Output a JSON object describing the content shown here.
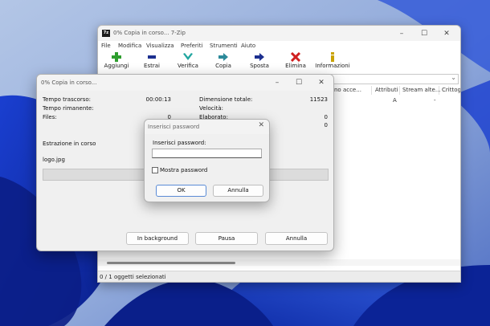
{
  "main_window": {
    "app_icon_text": "7z",
    "title": "0% Copia in corso... 7-Zip",
    "menu": [
      "File",
      "Modifica",
      "Visualizza",
      "Preferiti",
      "Strumenti",
      "Aiuto"
    ],
    "toolbar": [
      {
        "label": "Aggiungi",
        "icon": "plus-icon",
        "color": "#2e9e2e"
      },
      {
        "label": "Estrai",
        "icon": "minus-icon",
        "color": "#1c2f8f"
      },
      {
        "label": "Verifica",
        "icon": "check-icon",
        "color": "#22a6a0"
      },
      {
        "label": "Copia",
        "icon": "arrow-right-icon",
        "color": "#2c8a9a"
      },
      {
        "label": "Sposta",
        "icon": "arrow-right-icon",
        "color": "#1c2f8f"
      },
      {
        "label": "Elimina",
        "icon": "x-icon",
        "color": "#d02020"
      },
      {
        "label": "Informazioni",
        "icon": "info-icon",
        "color": "#c9a200"
      }
    ],
    "columns": [
      "no acce...",
      "Attributi",
      "Stream alte...",
      "Crittog"
    ],
    "row": {
      "attributi": "A",
      "stream": "-"
    },
    "status": "0 / 1 oggetti selezionati"
  },
  "progress_dialog": {
    "title": "0% Copia in corso...",
    "tempo_trascorso_label": "Tempo trascorso:",
    "tempo_trascorso_value": "00:00:13",
    "tempo_rimanente_label": "Tempo rimanente:",
    "files_label": "Files:",
    "files_value": "0",
    "dimensione_label": "Dimensione totale:",
    "dimensione_value": "11523",
    "velocita_label": "Velocità:",
    "elaborato_label": "Elaborato:",
    "elaborato_value": "0",
    "extra_value": "0",
    "estrazione_label": "Estrazione in corso",
    "file_name": "logo.jpg",
    "progress_percent": 0,
    "buttons": {
      "background": "In background",
      "pause": "Pausa",
      "cancel": "Annulla"
    }
  },
  "password_dialog": {
    "title": "Inserisci password",
    "field_label": "Inserisci password:",
    "field_value": "",
    "show_password_label": "Mostra password",
    "show_password_checked": false,
    "ok_label": "OK",
    "cancel_label": "Annulla"
  }
}
